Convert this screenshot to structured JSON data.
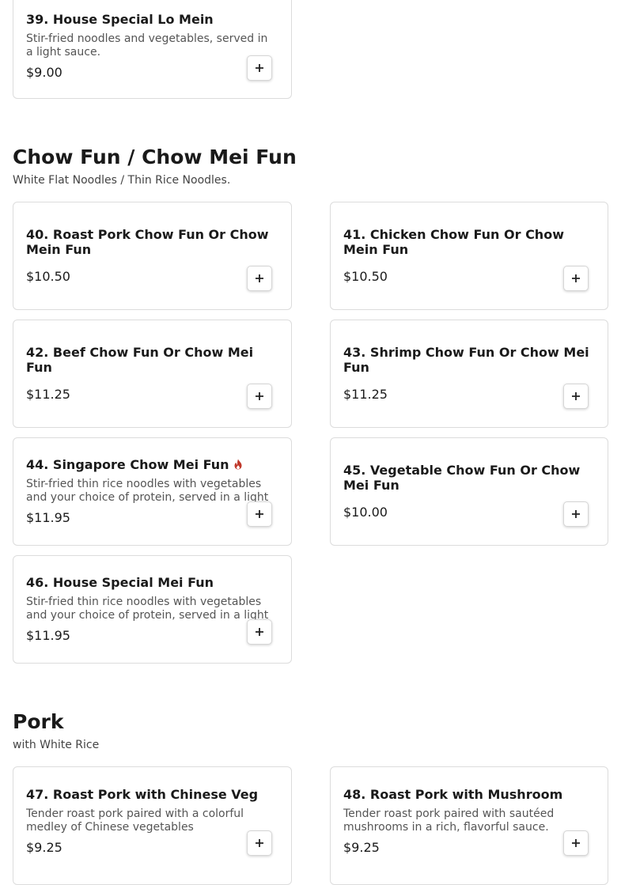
{
  "sections": [
    {
      "items": [
        {
          "name": "39. House Special Lo Mein",
          "description": "Stir-fried noodles and vegetables, served in a light sauce.",
          "price": "$9.00"
        }
      ]
    },
    {
      "title": "Chow Fun / Chow Mei Fun",
      "subtitle": "White Flat Noodles / Thin Rice Noodles.",
      "items": [
        {
          "name": "40. Roast Pork Chow Fun Or Chow Mein Fun",
          "price": "$10.50"
        },
        {
          "name": "41. Chicken Chow Fun Or Chow Mein Fun",
          "price": "$10.50"
        },
        {
          "name": "42. Beef Chow Fun Or Chow Mei Fun",
          "price": "$11.25"
        },
        {
          "name": "43. Shrimp Chow Fun Or Chow Mei Fun",
          "price": "$11.25"
        },
        {
          "name": "44. Singapore Chow Mei Fun",
          "description": "Stir-fried thin rice noodles with vegetables and your choice of protein, served in a light sauce.",
          "price": "$11.95",
          "badge_icon": "spicy-flame-icon"
        },
        {
          "name": "45. Vegetable Chow Fun Or Chow Mei Fun",
          "price": "$10.00"
        },
        {
          "name": "46. House Special Mei Fun",
          "description": "Stir-fried thin rice noodles with vegetables and your choice of protein, served in a light sauce.",
          "price": "$11.95"
        }
      ]
    },
    {
      "title": "Pork",
      "subtitle": "with White Rice",
      "items": [
        {
          "name": "47. Roast Pork with Chinese Veg",
          "description": "Tender roast pork paired with a colorful medley of Chinese vegetables",
          "price": "$9.25"
        },
        {
          "name": "48. Roast Pork with Mushroom",
          "description": "Tender roast pork paired with sautéed mushrooms in a rich, flavorful sauce.",
          "price": "$9.25"
        }
      ]
    }
  ],
  "add_button_icon": "plus-icon",
  "colors": {
    "spicy": "#c0392b",
    "border": "#dcdcdc"
  }
}
